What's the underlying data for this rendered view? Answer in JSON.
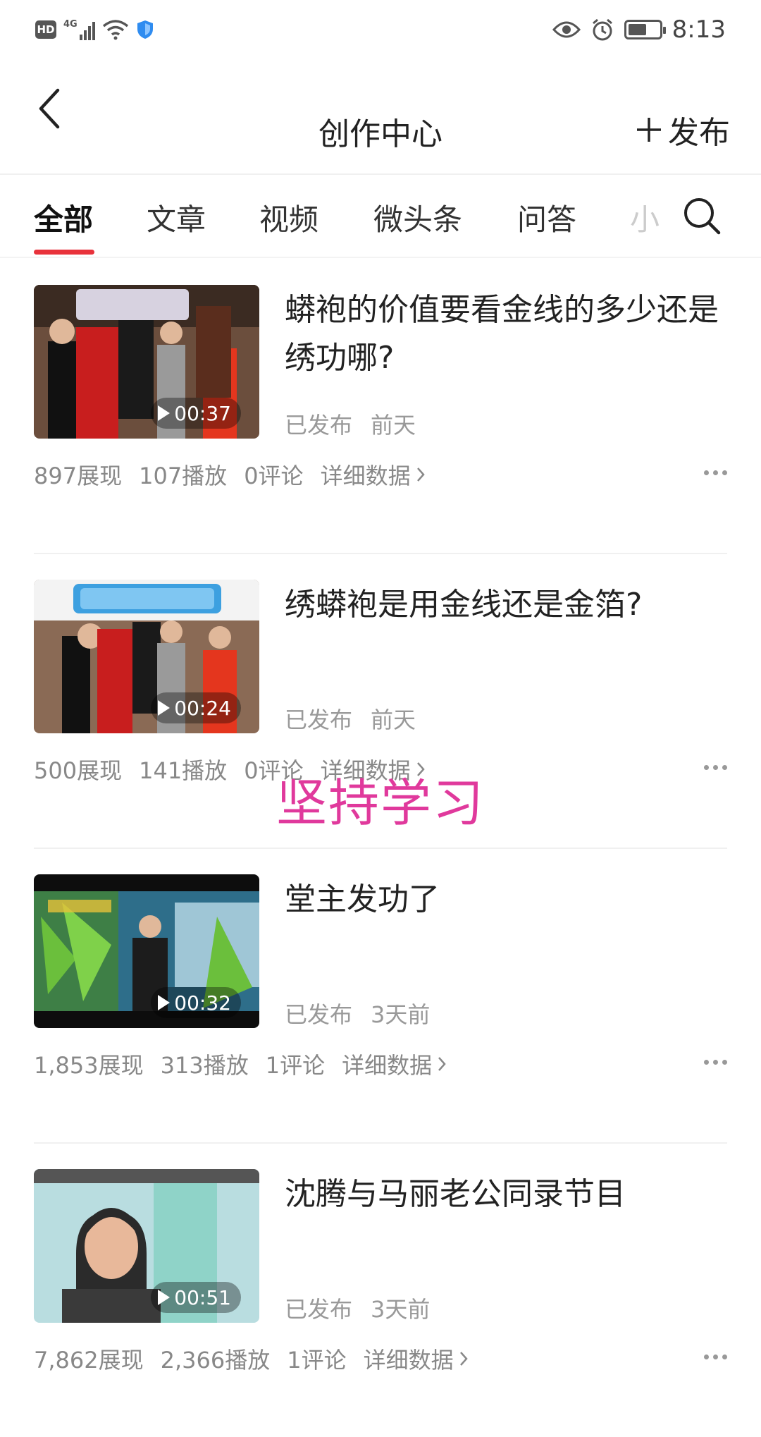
{
  "status_bar": {
    "hd": "HD",
    "network": "4G",
    "time": "8:13"
  },
  "header": {
    "title": "创作中心",
    "publish_label": "发布"
  },
  "tabs": [
    "全部",
    "文章",
    "视频",
    "微头条",
    "问答"
  ],
  "tab_overflow": "小",
  "items": [
    {
      "title": "蟒袍的价值要看金线的多少还是绣功哪?",
      "duration": "00:37",
      "status": "已发布",
      "time": "前天",
      "impressions": "897展现",
      "plays": "107播放",
      "comments": "0评论",
      "detail": "详细数据"
    },
    {
      "title": "绣蟒袍是用金线还是金箔?",
      "duration": "00:24",
      "status": "已发布",
      "time": "前天",
      "impressions": "500展现",
      "plays": "141播放",
      "comments": "0评论",
      "detail": "详细数据"
    },
    {
      "title": "堂主发功了",
      "duration": "00:32",
      "status": "已发布",
      "time": "3天前",
      "impressions": "1,853展现",
      "plays": "313播放",
      "comments": "1评论",
      "detail": "详细数据"
    },
    {
      "title": "沈腾与马丽老公同录节目",
      "duration": "00:51",
      "status": "已发布",
      "time": "3天前",
      "impressions": "7,862展现",
      "plays": "2,366播放",
      "comments": "1评论",
      "detail": "详细数据"
    }
  ],
  "watermark": "坚持学习",
  "colors": {
    "accent": "#e8323b",
    "watermark": "#e0399c",
    "meta": "#888888"
  }
}
